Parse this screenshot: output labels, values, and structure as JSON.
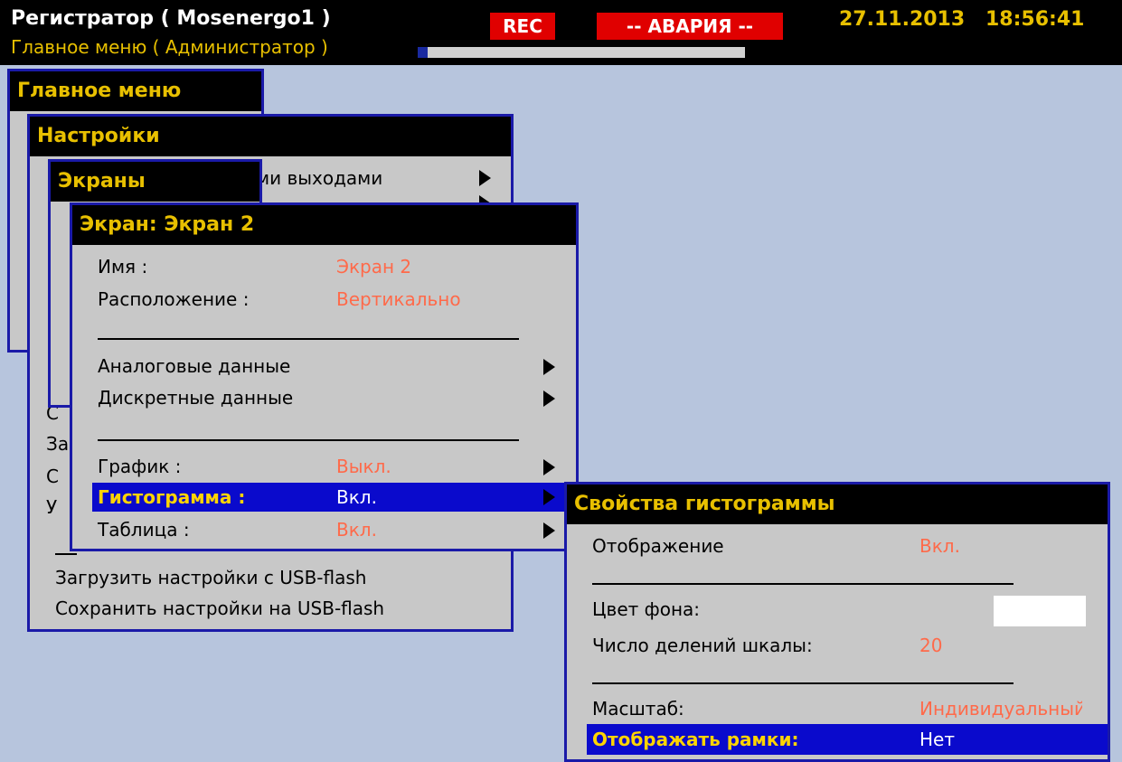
{
  "header": {
    "title": "Регистратор ( Mosenergo1 )",
    "subtitle": "Главное меню ( Администратор )",
    "rec_label": "REC",
    "alarm_label": "-- АВАРИЯ --",
    "date": "27.11.2013",
    "time": "18:56:41",
    "progress_fraction": 0.03
  },
  "main_menu": {
    "title": "Главное меню"
  },
  "settings_menu": {
    "title": "Настройки",
    "item_partial": "ми выходами",
    "cut_letters": [
      "С",
      "За",
      "С",
      "У"
    ],
    "load_usb": "Загрузить настройки с USB-flash",
    "save_usb": "Сохранить настройки на USB-flash"
  },
  "screens_menu": {
    "title": "Экраны"
  },
  "screen_menu": {
    "title": "Экран: Экран 2",
    "name_label": "Имя :",
    "name_value": "Экран 2",
    "layout_label": "Расположение :",
    "layout_value": "Вертикально",
    "analog_label": "Аналоговые данные",
    "discrete_label": "Дискретные данные",
    "graph_label": "График :",
    "graph_value": "Выкл.",
    "histogram_label": "Гистограмма :",
    "histogram_value": "Вкл.",
    "table_label": "Таблица :",
    "table_value": "Вкл."
  },
  "hist_props": {
    "title": "Свойства гистограммы",
    "display_label": "Отображение",
    "display_value": "Вкл.",
    "bg_label": "Цвет фона:",
    "bg_color": "#ffffff",
    "divisions_label": "Число делений шкалы:",
    "divisions_value": "20",
    "scale_label": "Масштаб:",
    "scale_value": "Индивидуальный",
    "frames_label": "Отображать рамки:",
    "frames_value": "Нет"
  },
  "colors": {
    "background": "#b7c5dd",
    "title_bar": "#000000",
    "title_text": "#e8c000",
    "window_border": "#1a1aa8",
    "window_bg": "#c8c8c8",
    "value_text": "#ff6a4a",
    "selection": "#0a0acc",
    "alarm": "#e00000"
  }
}
